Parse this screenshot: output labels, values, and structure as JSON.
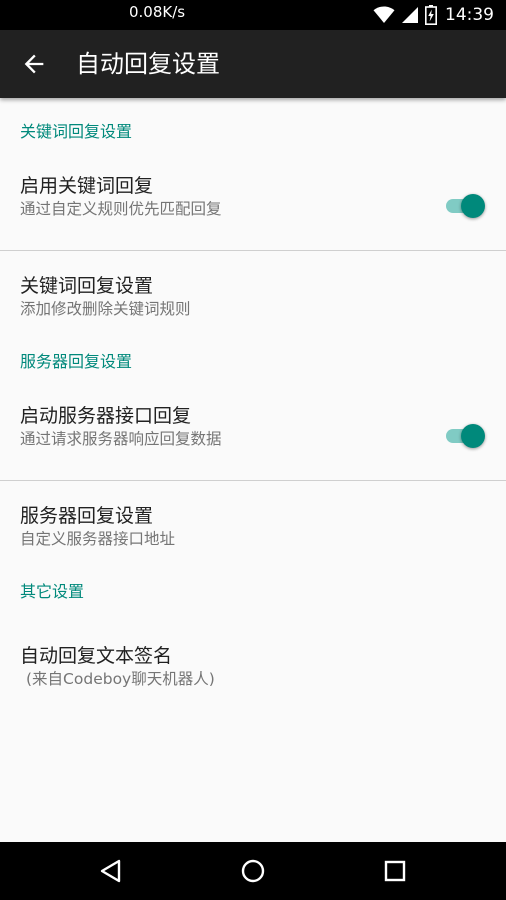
{
  "status_bar": {
    "network_speed": "0.08K/s",
    "time": "14:39",
    "icons": [
      "wifi-icon",
      "cell-signal-icon",
      "battery-charging-icon"
    ]
  },
  "app_bar": {
    "title": "自动回复设置",
    "back_icon": "arrow-back-icon"
  },
  "sections": {
    "keyword": {
      "header": "关键词回复设置",
      "enable": {
        "title": "启用关键词回复",
        "summary": "通过自定义规则优先匹配回复",
        "checked": true
      },
      "settings": {
        "title": "关键词回复设置",
        "summary": "添加修改删除关键词规则"
      }
    },
    "server": {
      "header": "服务器回复设置",
      "enable": {
        "title": "启动服务器接口回复",
        "summary": "通过请求服务器响应回复数据",
        "checked": true
      },
      "settings": {
        "title": "服务器回复设置",
        "summary": "自定义服务器接口地址"
      }
    },
    "other": {
      "header": "其它设置",
      "signature": {
        "title": "自动回复文本签名",
        "summary": "(来自Codeboy聊天机器人)"
      }
    }
  },
  "nav_bar": {
    "icons": [
      "back-triangle-icon",
      "home-circle-icon",
      "recents-square-icon"
    ]
  },
  "colors": {
    "accent": "#00897b",
    "accent_light": "#80cbc4",
    "app_bar": "#212121",
    "background": "#fafafa"
  }
}
